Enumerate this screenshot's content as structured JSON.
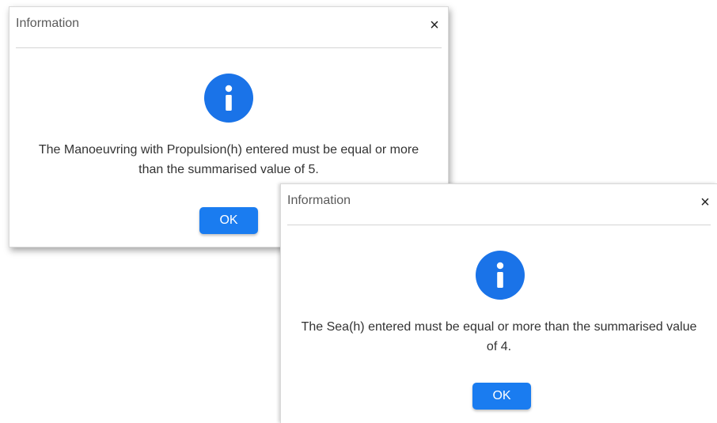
{
  "dialogs": [
    {
      "title": "Information",
      "close_glyph": "×",
      "icon": "info-icon",
      "message_line1": "The Manoeuvring with Propulsion(h) entered must be equal or more",
      "message_line2": "than the summarised value of 5.",
      "ok_label": "OK"
    },
    {
      "title": "Information",
      "close_glyph": "×",
      "icon": "info-icon",
      "message_line1": "The Sea(h) entered must be equal or more than the summarised value",
      "message_line2": "of 4.",
      "ok_label": "OK"
    }
  ],
  "colors": {
    "accent": "#1a73e8",
    "button": "#1a7cf0",
    "divider": "#d4d4d4"
  }
}
